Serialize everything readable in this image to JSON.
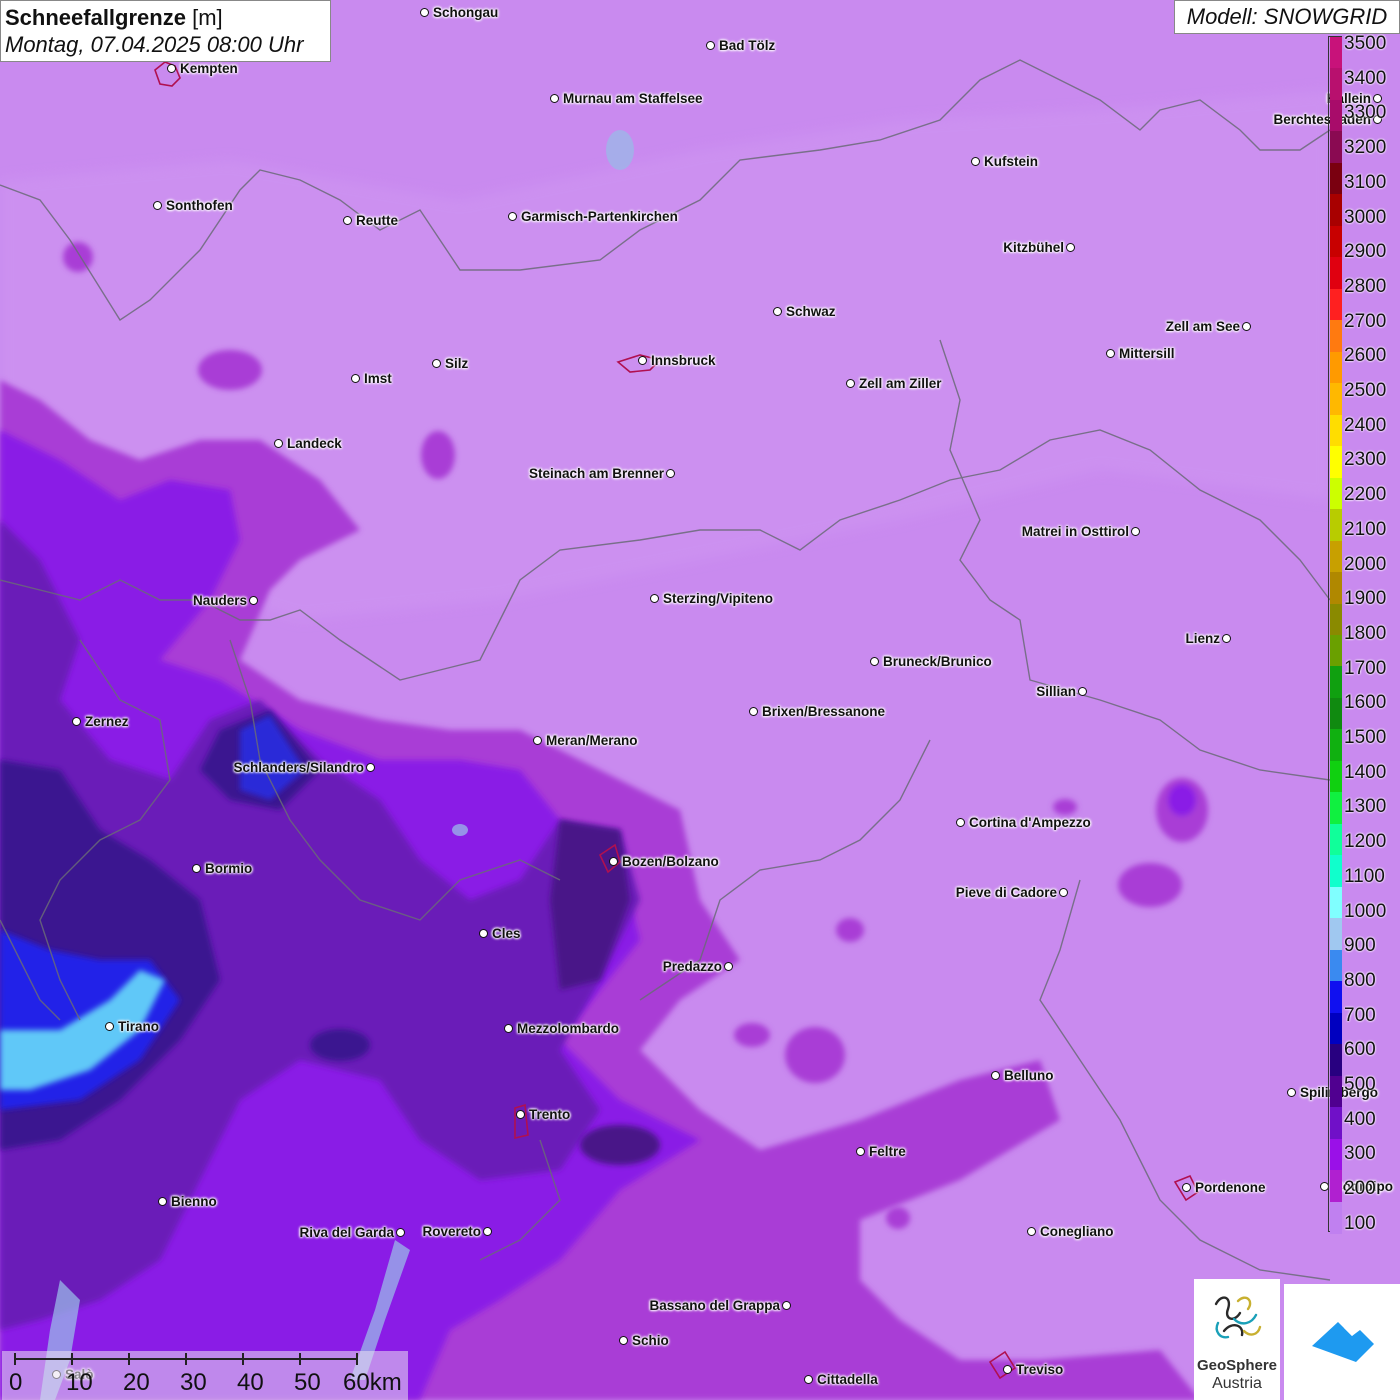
{
  "header": {
    "title": "Schneefallgrenze",
    "unit": "[m]",
    "timestamp": "Montag, 07.04.2025 08:00 Uhr",
    "model": "Modell: SNOWGRID"
  },
  "legend": {
    "labels": [
      "3500",
      "3400",
      "3300",
      "3200",
      "3100",
      "3000",
      "2900",
      "2800",
      "2700",
      "2600",
      "2500",
      "2400",
      "2300",
      "2200",
      "2100",
      "2000",
      "1900",
      "1800",
      "1700",
      "1600",
      "1500",
      "1400",
      "1300",
      "1200",
      "1100",
      "1000",
      "900",
      "800",
      "700",
      "600",
      "500",
      "400",
      "300",
      "200",
      "100"
    ],
    "colors": [
      "#c8127a",
      "#b8106e",
      "#a80c6a",
      "#8a0a52",
      "#7a0010",
      "#a80000",
      "#c80000",
      "#e00010",
      "#ff2020",
      "#ff7a10",
      "#ff9a00",
      "#ffb800",
      "#ffdd00",
      "#ffff00",
      "#ccff00",
      "#b8cc00",
      "#c8a000",
      "#b08800",
      "#8a8a00",
      "#6aa000",
      "#10a010",
      "#108a10",
      "#10b010",
      "#10d010",
      "#10f040",
      "#10ff9a",
      "#10ffcc",
      "#80ffff",
      "#a0c8f0",
      "#3a8af0",
      "#1010f0",
      "#0000c0",
      "#280080",
      "#500090",
      "#7010c8",
      "#9a10e8",
      "#b020d0",
      "#c080f0"
    ]
  },
  "cities": [
    {
      "name": "Schongau",
      "side": "r"
    },
    {
      "name": "Bad Tölz",
      "side": "r"
    },
    {
      "name": "Kempten",
      "side": "r"
    },
    {
      "name": "Murnau am Staffelsee",
      "side": "r"
    },
    {
      "name": "Hallein",
      "side": "l"
    },
    {
      "name": "Berchtesgaden",
      "side": "l"
    },
    {
      "name": "Kufstein",
      "side": "r"
    },
    {
      "name": "Sonthofen",
      "side": "r"
    },
    {
      "name": "Reutte",
      "side": "r"
    },
    {
      "name": "Garmisch-Partenkirchen",
      "side": "r"
    },
    {
      "name": "Kitzbühel",
      "side": "l"
    },
    {
      "name": "Schwaz",
      "side": "r"
    },
    {
      "name": "Zell am See",
      "side": "l"
    },
    {
      "name": "Mittersill",
      "side": "r"
    },
    {
      "name": "Innsbruck",
      "side": "r"
    },
    {
      "name": "Imst",
      "side": "r"
    },
    {
      "name": "Silz",
      "side": "r"
    },
    {
      "name": "Zell am Ziller",
      "side": "r"
    },
    {
      "name": "Landeck",
      "side": "r"
    },
    {
      "name": "Steinach am Brenner",
      "side": "l"
    },
    {
      "name": "Matrei in Osttirol",
      "side": "l"
    },
    {
      "name": "Nauders",
      "side": "l"
    },
    {
      "name": "Sterzing/Vipiteno",
      "side": "r"
    },
    {
      "name": "Lienz",
      "side": "l"
    },
    {
      "name": "Bruneck/Brunico",
      "side": "r"
    },
    {
      "name": "Sillian",
      "side": "l"
    },
    {
      "name": "Zernez",
      "side": "r"
    },
    {
      "name": "Brixen/Bressanone",
      "side": "r"
    },
    {
      "name": "Meran/Merano",
      "side": "r"
    },
    {
      "name": "Schlanders/Silandro",
      "side": "l"
    },
    {
      "name": "Cortina d'Ampezzo",
      "side": "r"
    },
    {
      "name": "Bozen/Bolzano",
      "side": "r"
    },
    {
      "name": "Bormio",
      "side": "r"
    },
    {
      "name": "Pieve di Cadore",
      "side": "l"
    },
    {
      "name": "Cles",
      "side": "r"
    },
    {
      "name": "Predazzo",
      "side": "l"
    },
    {
      "name": "Tirano",
      "side": "r"
    },
    {
      "name": "Mezzolombardo",
      "side": "r"
    },
    {
      "name": "Belluno",
      "side": "r"
    },
    {
      "name": "Spilimbergo",
      "side": "r"
    },
    {
      "name": "Trento",
      "side": "r"
    },
    {
      "name": "Feltre",
      "side": "r"
    },
    {
      "name": "Pordenone",
      "side": "r"
    },
    {
      "name": "Codroipo",
      "side": "r"
    },
    {
      "name": "Bienno",
      "side": "r"
    },
    {
      "name": "Riva del Garda",
      "side": "l"
    },
    {
      "name": "Rovereto",
      "side": "l"
    },
    {
      "name": "Conegliano",
      "side": "r"
    },
    {
      "name": "Bassano del Grappa",
      "side": "l"
    },
    {
      "name": "Schio",
      "side": "r"
    },
    {
      "name": "Treviso",
      "side": "r"
    },
    {
      "name": "Cittadella",
      "side": "r"
    },
    {
      "name": "Salò",
      "side": "r"
    }
  ],
  "scale_bar": {
    "labels": [
      "0",
      "10",
      "20",
      "30",
      "40",
      "50",
      "60km"
    ]
  },
  "logos": {
    "geosphere_line1": "GeoSphere",
    "geosphere_line2": "Austria"
  }
}
